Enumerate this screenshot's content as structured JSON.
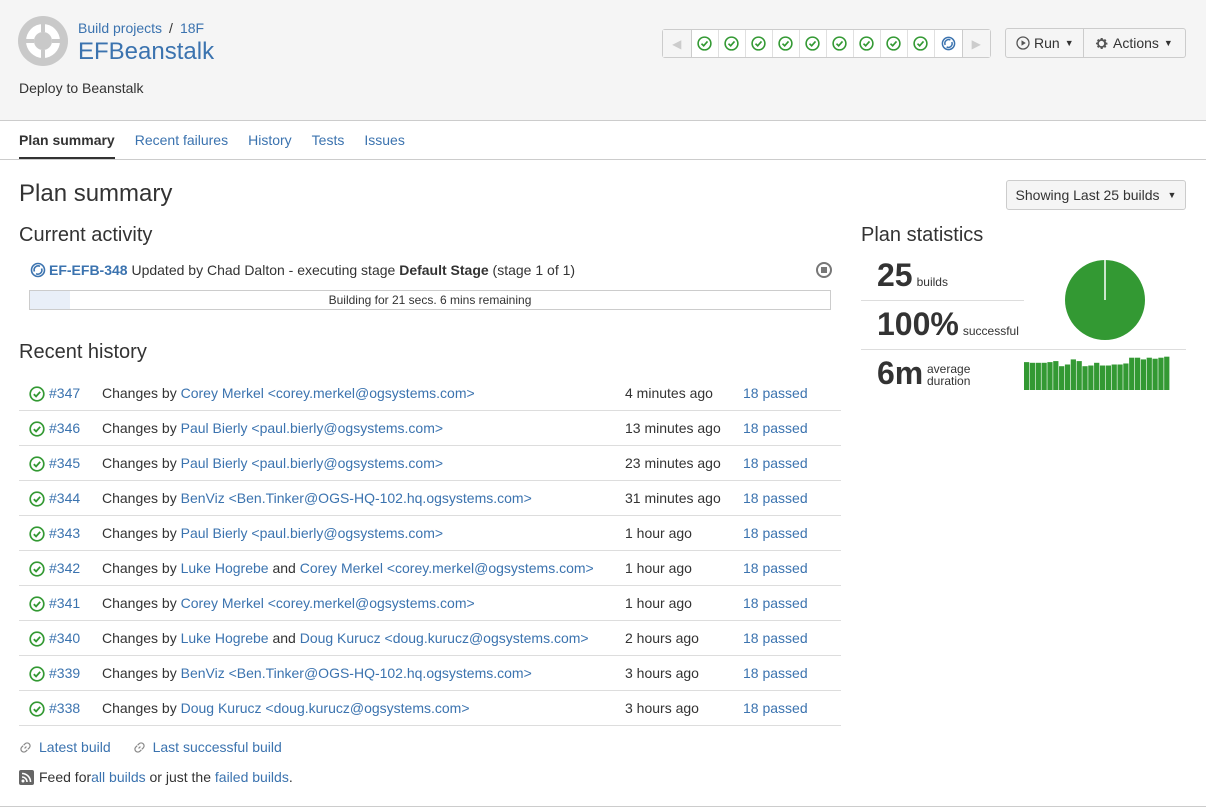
{
  "header": {
    "breadcrumb": [
      "Build projects",
      "18F"
    ],
    "title": "EFBeanstalk",
    "description": "Deploy to Beanstalk",
    "build_strip": [
      "success",
      "success",
      "success",
      "success",
      "success",
      "success",
      "success",
      "success",
      "success",
      "in-progress"
    ],
    "run_label": "Run",
    "actions_label": "Actions"
  },
  "tabs": [
    {
      "label": "Plan summary",
      "active": true
    },
    {
      "label": "Recent failures"
    },
    {
      "label": "History"
    },
    {
      "label": "Tests"
    },
    {
      "label": "Issues"
    }
  ],
  "main": {
    "title": "Plan summary",
    "showing_label": "Showing Last 25 builds",
    "current_activity": {
      "heading": "Current activity",
      "build_key": "EF-EFB-348",
      "text_1": " Updated by Chad Dalton - executing stage ",
      "stage": "Default Stage",
      "text_2": " (stage 1 of 1)",
      "progress_text": "Building for 21 secs. 6 mins remaining",
      "progress_fraction": 0.05
    },
    "recent_history": {
      "heading": "Recent history",
      "rows": [
        {
          "num": "#347",
          "prefix": "Changes by ",
          "parts": [
            {
              "t": "Corey Merkel",
              "link": true
            },
            {
              "t": " <corey.merkel@ogsystems.com>",
              "link": true
            }
          ],
          "time": "4 minutes ago",
          "tests": "18 passed"
        },
        {
          "num": "#346",
          "prefix": "Changes by ",
          "parts": [
            {
              "t": "Paul Bierly",
              "link": true
            },
            {
              "t": " <paul.bierly@ogsystems.com>",
              "link": true
            }
          ],
          "time": "13 minutes ago",
          "tests": "18 passed"
        },
        {
          "num": "#345",
          "prefix": "Changes by ",
          "parts": [
            {
              "t": "Paul Bierly",
              "link": true
            },
            {
              "t": " <paul.bierly@ogsystems.com>",
              "link": true
            }
          ],
          "time": "23 minutes ago",
          "tests": "18 passed"
        },
        {
          "num": "#344",
          "prefix": "Changes by ",
          "parts": [
            {
              "t": "BenViz",
              "link": true
            },
            {
              "t": " <Ben.Tinker@OGS-HQ-102.hq.ogsystems.com>",
              "link": true
            }
          ],
          "time": "31 minutes ago",
          "tests": "18 passed"
        },
        {
          "num": "#343",
          "prefix": "Changes by ",
          "parts": [
            {
              "t": "Paul Bierly",
              "link": true
            },
            {
              "t": " <paul.bierly@ogsystems.com>",
              "link": true
            }
          ],
          "time": "1 hour ago",
          "tests": "18 passed"
        },
        {
          "num": "#342",
          "prefix": "Changes by ",
          "parts": [
            {
              "t": "Luke Hogrebe",
              "link": true
            },
            {
              "t": " and ",
              "link": false
            },
            {
              "t": "Corey Merkel <corey.merkel@ogsystems.com>",
              "link": true
            }
          ],
          "time": "1 hour ago",
          "tests": "18 passed"
        },
        {
          "num": "#341",
          "prefix": "Changes by ",
          "parts": [
            {
              "t": "Corey Merkel",
              "link": true
            },
            {
              "t": " <corey.merkel@ogsystems.com>",
              "link": true
            }
          ],
          "time": "1 hour ago",
          "tests": "18 passed"
        },
        {
          "num": "#340",
          "prefix": "Changes by ",
          "parts": [
            {
              "t": "Luke Hogrebe",
              "link": true
            },
            {
              "t": " and ",
              "link": false
            },
            {
              "t": "Doug Kurucz <doug.kurucz@ogsystems.com>",
              "link": true
            }
          ],
          "time": "2 hours ago",
          "tests": "18 passed"
        },
        {
          "num": "#339",
          "prefix": "Changes by ",
          "parts": [
            {
              "t": "BenViz",
              "link": true
            },
            {
              "t": " <Ben.Tinker@OGS-HQ-102.hq.ogsystems.com>",
              "link": true
            }
          ],
          "time": "3 hours ago",
          "tests": "18 passed"
        },
        {
          "num": "#338",
          "prefix": "Changes by ",
          "parts": [
            {
              "t": "Doug Kurucz",
              "link": true
            },
            {
              "t": " <doug.kurucz@ogsystems.com>",
              "link": true
            }
          ],
          "time": "3 hours ago",
          "tests": "18 passed"
        }
      ]
    },
    "links": {
      "latest_build": "Latest build",
      "last_successful": "Last successful build",
      "feed_prefix": "Feed for ",
      "feed_all": "all builds",
      "feed_mid": " or just the ",
      "feed_failed": "failed builds",
      "feed_suffix": "."
    }
  },
  "stats": {
    "heading": "Plan statistics",
    "builds_value": "25",
    "builds_label": "builds",
    "success_value": "100%",
    "success_label": "successful",
    "duration_value": "6m",
    "duration_label_1": "average",
    "duration_label_2": "duration",
    "success_fraction": 1.0,
    "colors": {
      "success": "#339933",
      "link": "#3b73af"
    },
    "duration_bars": [
      0.82,
      0.8,
      0.8,
      0.8,
      0.82,
      0.85,
      0.7,
      0.75,
      0.9,
      0.85,
      0.7,
      0.72,
      0.8,
      0.72,
      0.72,
      0.75,
      0.75,
      0.78,
      0.95,
      0.95,
      0.9,
      0.95,
      0.92,
      0.95,
      0.98
    ]
  }
}
